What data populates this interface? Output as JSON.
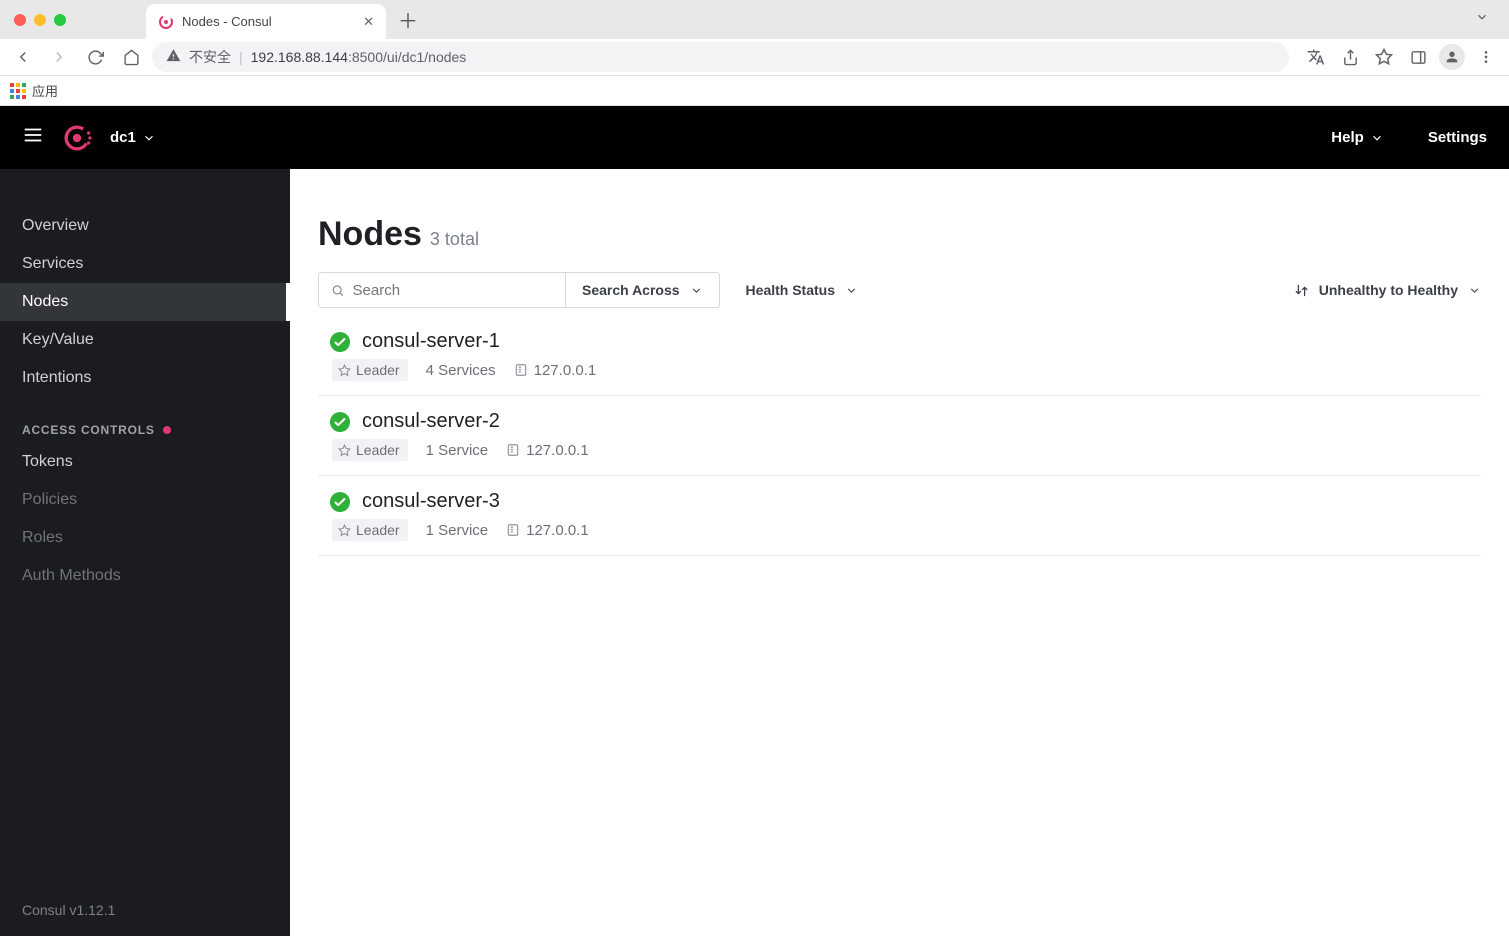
{
  "browser": {
    "tab_title": "Nodes - Consul",
    "security_label": "不安全",
    "url_host": "192.168.88.144",
    "url_port": ":8500",
    "url_path": "/ui/dc1/nodes",
    "bookmark_apps": "应用"
  },
  "header": {
    "datacenter": "dc1",
    "help": "Help",
    "settings": "Settings"
  },
  "sidebar": {
    "items": [
      {
        "label": "Overview"
      },
      {
        "label": "Services"
      },
      {
        "label": "Nodes"
      },
      {
        "label": "Key/Value"
      },
      {
        "label": "Intentions"
      }
    ],
    "section_label": "ACCESS CONTROLS",
    "access_items": [
      {
        "label": "Tokens"
      },
      {
        "label": "Policies"
      },
      {
        "label": "Roles"
      },
      {
        "label": "Auth Methods"
      }
    ],
    "version": "Consul v1.12.1"
  },
  "page": {
    "title": "Nodes",
    "count_label": "3 total",
    "search_placeholder": "Search",
    "search_across_label": "Search Across",
    "health_status_label": "Health Status",
    "sort_label": "Unhealthy to Healthy"
  },
  "nodes": [
    {
      "name": "consul-server-1",
      "leader": "Leader",
      "services": "4 Services",
      "address": "127.0.0.1"
    },
    {
      "name": "consul-server-2",
      "leader": "Leader",
      "services": "1 Service",
      "address": "127.0.0.1"
    },
    {
      "name": "consul-server-3",
      "leader": "Leader",
      "services": "1 Service",
      "address": "127.0.0.1"
    }
  ]
}
